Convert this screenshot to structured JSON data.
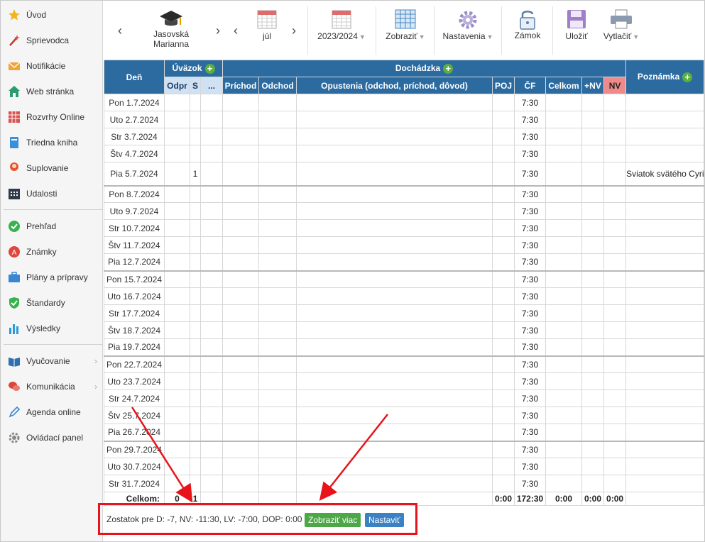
{
  "sidebar": {
    "items": [
      {
        "label": "Úvod",
        "icon": "star-icon"
      },
      {
        "label": "Sprievodca",
        "icon": "magic-wand-icon"
      },
      {
        "label": "Notifikácie",
        "icon": "envelope-icon"
      },
      {
        "label": "Web stránka",
        "icon": "home-icon"
      },
      {
        "label": "Rozvrhy Online",
        "icon": "timetable-icon"
      },
      {
        "label": "Triedna kniha",
        "icon": "book-icon"
      },
      {
        "label": "Suplovanie",
        "icon": "user-icon"
      },
      {
        "label": "Udalosti",
        "icon": "calendar-icon"
      },
      {
        "label": "Prehľad",
        "icon": "check-circle-icon"
      },
      {
        "label": "Známky",
        "icon": "grades-icon"
      },
      {
        "label": "Plány a prípravy",
        "icon": "briefcase-icon"
      },
      {
        "label": "Štandardy",
        "icon": "shield-icon"
      },
      {
        "label": "Výsledky",
        "icon": "bar-chart-icon"
      },
      {
        "label": "Vyučovanie",
        "icon": "open-book-icon"
      },
      {
        "label": "Komunikácia",
        "icon": "chat-icon"
      },
      {
        "label": "Agenda online",
        "icon": "pencil-icon"
      },
      {
        "label": "Ovládací panel",
        "icon": "gear-icon"
      }
    ]
  },
  "toolbar": {
    "teacher_line1": "Jasovská",
    "teacher_line2": "Marianna",
    "month": "júl",
    "year": "2023/2024",
    "show": "Zobraziť",
    "settings": "Nastavenia",
    "lock": "Zámok",
    "save": "Uložiť",
    "print": "Vytlačiť"
  },
  "table": {
    "headers": {
      "day": "Deň",
      "load": "Úväzok",
      "attendance": "Dochádzka",
      "note": "Poznámka",
      "odpr": "Odpr",
      "s": "S",
      "more": "...",
      "arrival": "Príchod",
      "departure": "Odchod",
      "absences": "Opustenia (odchod, príchod, dôvod)",
      "poj": "POJ",
      "cf": "ČF",
      "total": "Celkom",
      "plus_nv": "+NV",
      "nv": "NV"
    },
    "rows": [
      {
        "day": "Pon 1.7.2024",
        "cf": "7:30",
        "s": "",
        "note": ""
      },
      {
        "day": "Uto 2.7.2024",
        "cf": "7:30",
        "s": "",
        "note": ""
      },
      {
        "day": "Str 3.7.2024",
        "cf": "7:30",
        "s": "",
        "note": ""
      },
      {
        "day": "Štv 4.7.2024",
        "cf": "7:30",
        "s": "",
        "note": ""
      },
      {
        "day": "Pia 5.7.2024",
        "cf": "7:30",
        "s": "1",
        "note": "Sviatok svätého Cyrila a Metoda"
      },
      {
        "day": "Pon 8.7.2024",
        "cf": "7:30",
        "s": "",
        "note": ""
      },
      {
        "day": "Uto 9.7.2024",
        "cf": "7:30",
        "s": "",
        "note": ""
      },
      {
        "day": "Str 10.7.2024",
        "cf": "7:30",
        "s": "",
        "note": ""
      },
      {
        "day": "Štv 11.7.2024",
        "cf": "7:30",
        "s": "",
        "note": ""
      },
      {
        "day": "Pia 12.7.2024",
        "cf": "7:30",
        "s": "",
        "note": ""
      },
      {
        "day": "Pon 15.7.2024",
        "cf": "7:30",
        "s": "",
        "note": ""
      },
      {
        "day": "Uto 16.7.2024",
        "cf": "7:30",
        "s": "",
        "note": ""
      },
      {
        "day": "Str 17.7.2024",
        "cf": "7:30",
        "s": "",
        "note": ""
      },
      {
        "day": "Štv 18.7.2024",
        "cf": "7:30",
        "s": "",
        "note": ""
      },
      {
        "day": "Pia 19.7.2024",
        "cf": "7:30",
        "s": "",
        "note": ""
      },
      {
        "day": "Pon 22.7.2024",
        "cf": "7:30",
        "s": "",
        "note": ""
      },
      {
        "day": "Uto 23.7.2024",
        "cf": "7:30",
        "s": "",
        "note": ""
      },
      {
        "day": "Str 24.7.2024",
        "cf": "7:30",
        "s": "",
        "note": ""
      },
      {
        "day": "Štv 25.7.2024",
        "cf": "7:30",
        "s": "",
        "note": ""
      },
      {
        "day": "Pia 26.7.2024",
        "cf": "7:30",
        "s": "",
        "note": ""
      },
      {
        "day": "Pon 29.7.2024",
        "cf": "7:30",
        "s": "",
        "note": ""
      },
      {
        "day": "Uto 30.7.2024",
        "cf": "7:30",
        "s": "",
        "note": ""
      },
      {
        "day": "Str 31.7.2024",
        "cf": "7:30",
        "s": "",
        "note": ""
      }
    ],
    "totals": {
      "label": "Celkom:",
      "odpr": "0",
      "s": "1",
      "poj": "0:00",
      "cf": "172:30",
      "total": "0:00",
      "plus_nv": "0:00",
      "nv": "0:00"
    }
  },
  "footer": {
    "balance_text": "Zostatok pre D: -7, NV: -11:30, LV: -7:00, DOP: 0:00",
    "show_more": "Zobraziť viac",
    "set": "Nastaviť"
  },
  "colors": {
    "header_blue": "#2c6ba0",
    "plus_green": "#5aaf3f",
    "highlight_red": "#e8131b",
    "nv_pink": "#f08a8a"
  }
}
